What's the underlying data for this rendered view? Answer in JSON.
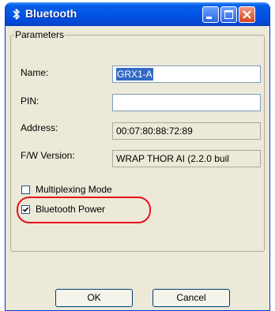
{
  "window": {
    "title": "Bluetooth",
    "app_icon": "bluetooth-icon",
    "controls": [
      "minimize-icon",
      "maximize-icon",
      "close-icon"
    ]
  },
  "parameters": {
    "legend": "Parameters",
    "name_label": "Name:",
    "name_value": "GRX1-A",
    "pin_label": "PIN:",
    "pin_value": "",
    "address_label": "Address:",
    "address_value": "00:07:80:88:72:89",
    "fw_label": "F/W Version:",
    "fw_value": "WRAP THOR AI (2.2.0 buil"
  },
  "options": {
    "multiplexing_label": "Multiplexing Mode",
    "multiplexing_checked": false,
    "bt_power_label": "Bluetooth Power",
    "bt_power_checked": true
  },
  "buttons": {
    "ok": "OK",
    "cancel": "Cancel"
  },
  "colors": {
    "titlebar": "#0055E5",
    "highlight": "#E8111A",
    "selection": "#316AC5"
  }
}
